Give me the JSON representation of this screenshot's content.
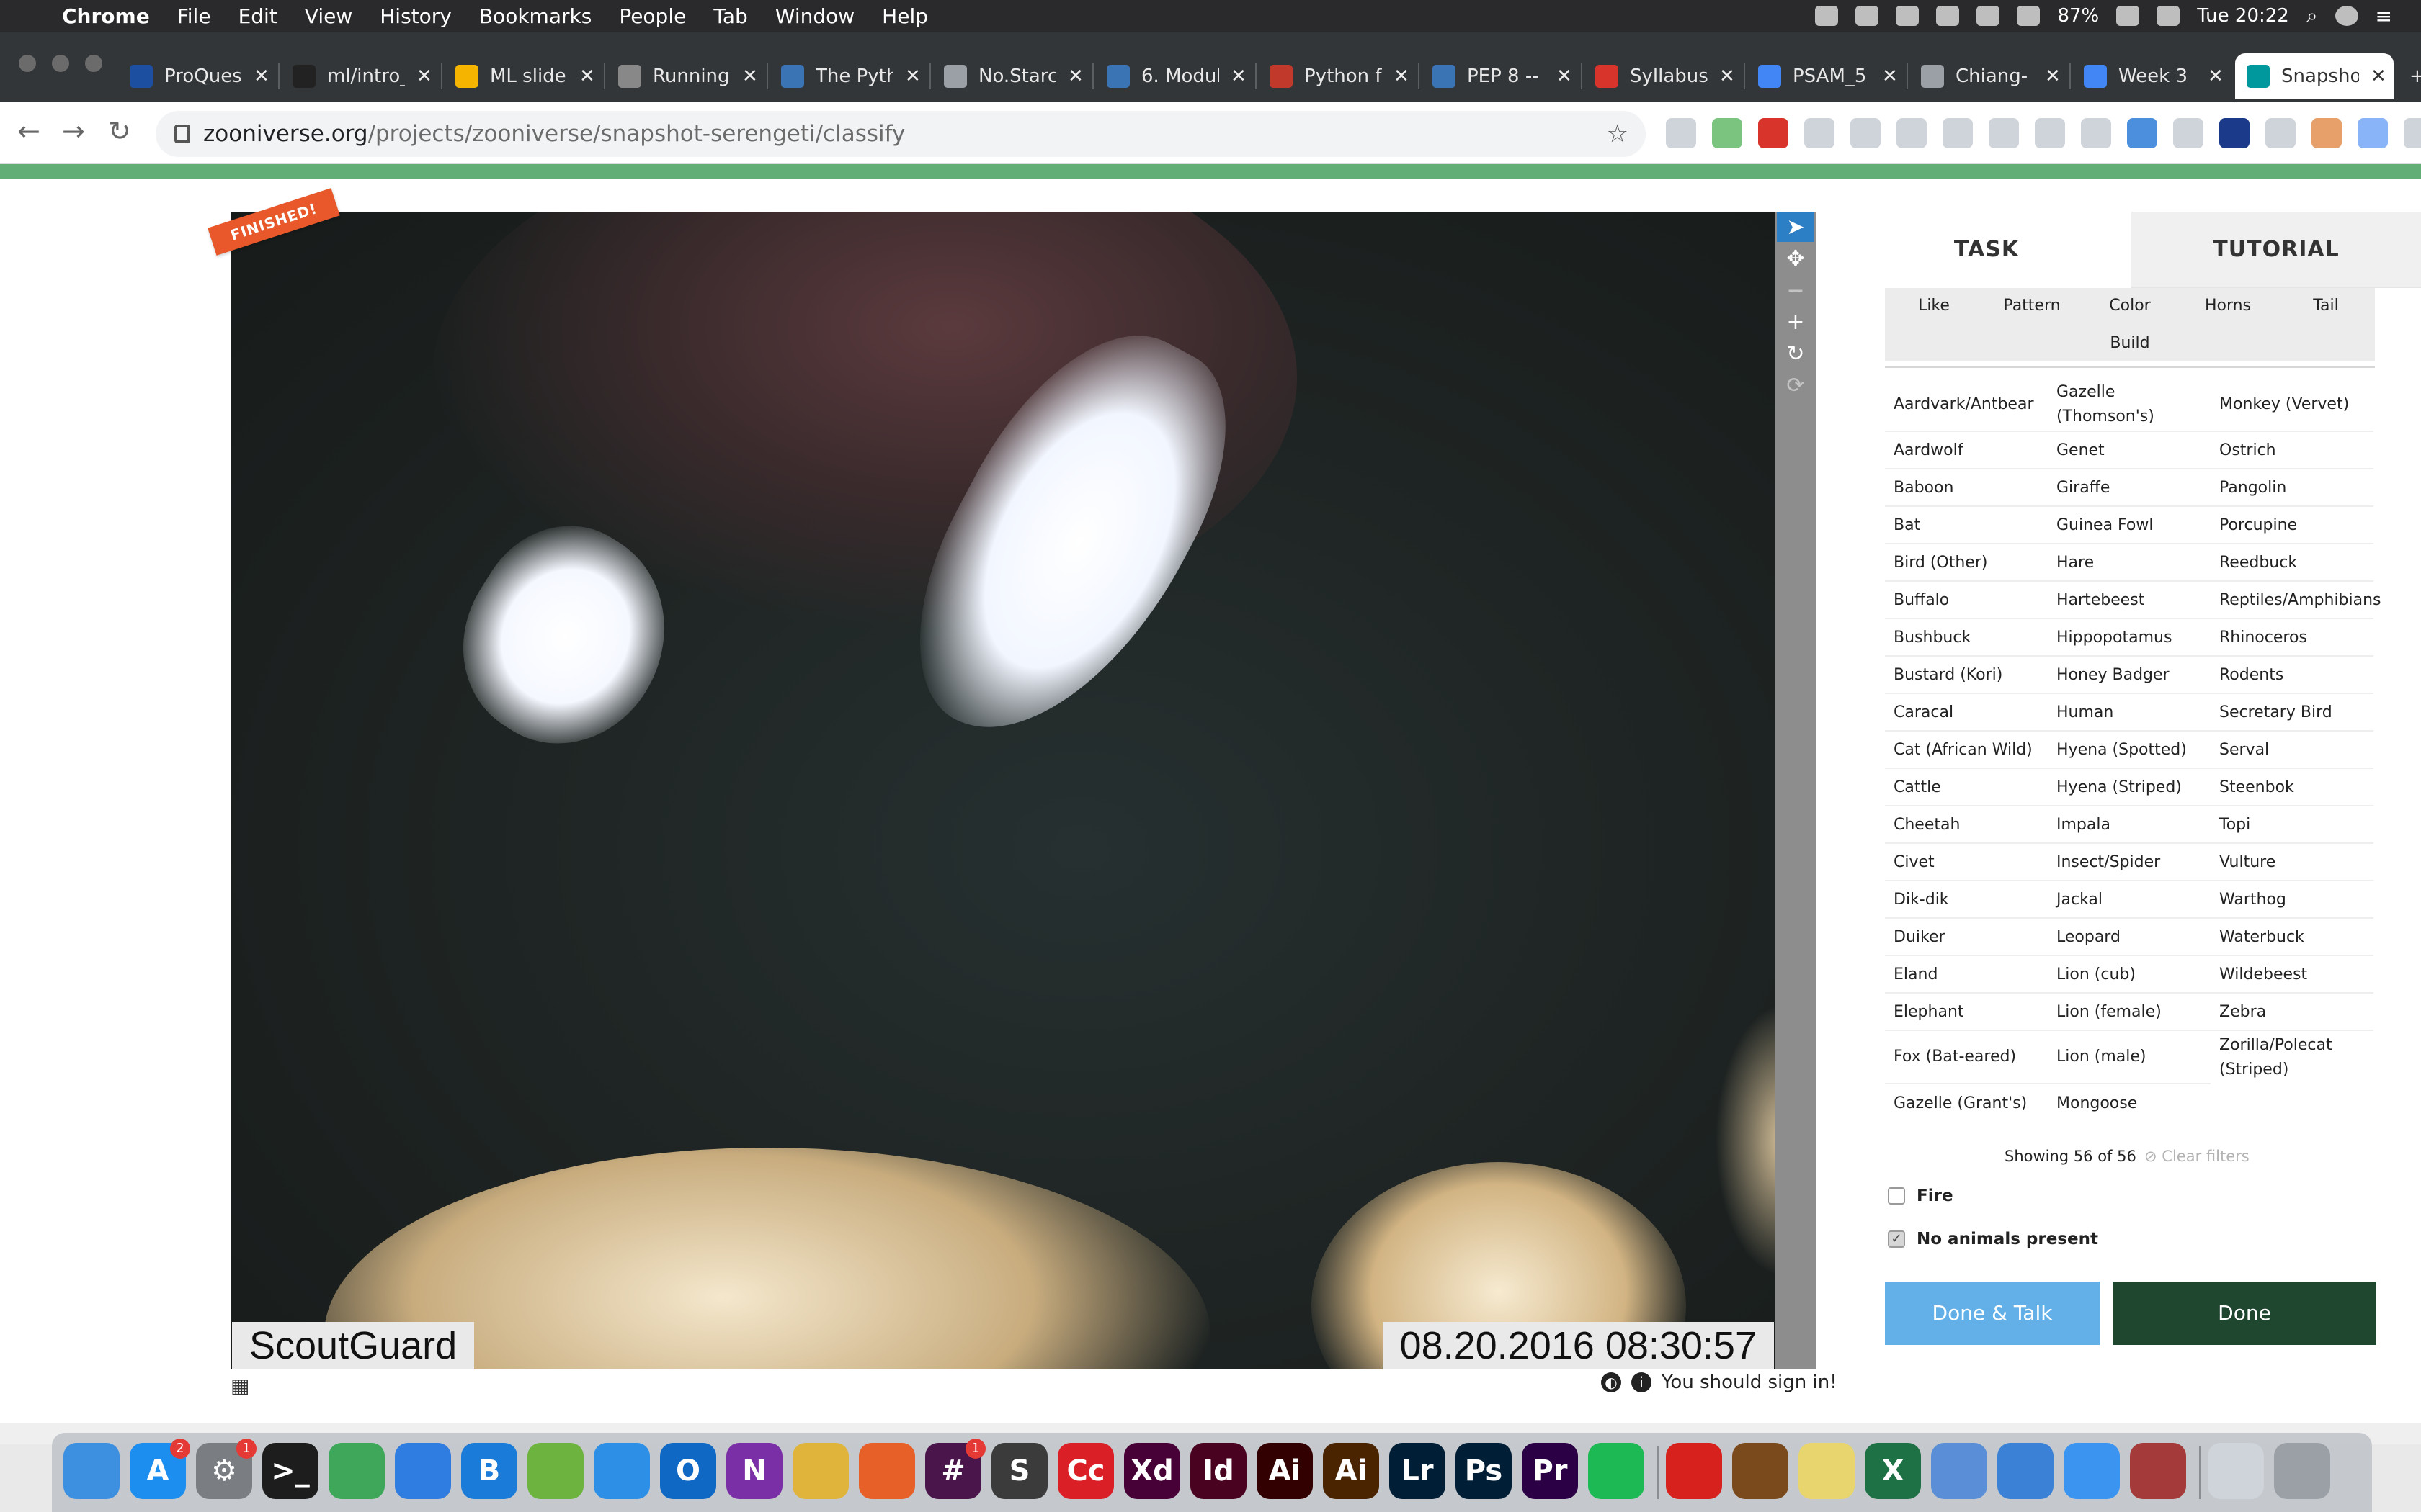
{
  "menubar": {
    "app_name": "Chrome",
    "items": [
      "File",
      "Edit",
      "View",
      "History",
      "Bookmarks",
      "People",
      "Tab",
      "Window",
      "Help"
    ],
    "battery": "87%",
    "clock": "Tue 20:22"
  },
  "tabs": [
    {
      "label": "ProQues",
      "color": "#1d4fa0"
    },
    {
      "label": "ml/intro_",
      "color": "#222222"
    },
    {
      "label": "ML slide",
      "color": "#f4b400"
    },
    {
      "label": "Running",
      "color": "#888888"
    },
    {
      "label": "The Pyth",
      "color": "#3b74b4"
    },
    {
      "label": "No.Starc",
      "color": "#9aa0a6"
    },
    {
      "label": "6. Modul",
      "color": "#3b74b4"
    },
    {
      "label": "Python f",
      "color": "#c0392b"
    },
    {
      "label": "PEP 8 --",
      "color": "#3b74b4"
    },
    {
      "label": "Syllabus",
      "color": "#d9342b"
    },
    {
      "label": "PSAM_5",
      "color": "#4285f4"
    },
    {
      "label": "Chiang-",
      "color": "#9aa0a6"
    },
    {
      "label": "Week 3",
      "color": "#4285f4"
    },
    {
      "label": "Snapsho",
      "color": "#00979d",
      "active": true
    }
  ],
  "address": {
    "host": "zooniverse.org",
    "path": "/projects/zooniverse/snapshot-serengeti/classify"
  },
  "subject": {
    "ribbon": "FINISHED!",
    "camera_brand": "ScoutGuard",
    "timestamp": "08.20.2016 08:30:57",
    "sign_in_notice": "You should sign in!"
  },
  "task_panel": {
    "tab_task": "TASK",
    "tab_tutorial": "TUTORIAL",
    "filters": [
      "Like",
      "Pattern",
      "Color",
      "Horns",
      "Tail",
      "Build"
    ],
    "species_columns": [
      [
        "Aardvark/Antbear",
        "Aardwolf",
        "Baboon",
        "Bat",
        "Bird (Other)",
        "Buffalo",
        "Bushbuck",
        "Bustard (Kori)",
        "Caracal",
        "Cat (African Wild)",
        "Cattle",
        "Cheetah",
        "Civet",
        "Dik-dik",
        "Duiker",
        "Eland",
        "Elephant",
        "Fox (Bat-eared)",
        "Gazelle (Grant's)"
      ],
      [
        "Gazelle (Thomson's)",
        "Genet",
        "Giraffe",
        "Guinea Fowl",
        "Hare",
        "Hartebeest",
        "Hippopotamus",
        "Honey Badger",
        "Human",
        "Hyena (Spotted)",
        "Hyena (Striped)",
        "Impala",
        "Insect/Spider",
        "Jackal",
        "Leopard",
        "Lion (cub)",
        "Lion (female)",
        "Lion (male)",
        "Mongoose"
      ],
      [
        "Monkey (Vervet)",
        "Ostrich",
        "Pangolin",
        "Porcupine",
        "Reedbuck",
        "Reptiles/Amphibians",
        "Rhinoceros",
        "Rodents",
        "Secretary Bird",
        "Serval",
        "Steenbok",
        "Topi",
        "Vulture",
        "Warthog",
        "Waterbuck",
        "Wildebeest",
        "Zebra",
        "Zorilla/Polecat (Striped)"
      ]
    ],
    "showing": "Showing 56 of 56",
    "clear_filters": "Clear filters",
    "fire_label": "Fire",
    "fire_checked": false,
    "no_animals_label": "No animals present",
    "no_animals_checked": true,
    "done_talk_label": "Done & Talk",
    "done_label": "Done"
  },
  "dock": [
    {
      "name": "Finder",
      "color": "#3d8fe0",
      "glyph": ""
    },
    {
      "name": "App Store",
      "color": "#1c8ef0",
      "glyph": "A",
      "badge": "2"
    },
    {
      "name": "System Preferences",
      "color": "#7a7d82",
      "glyph": "⚙",
      "badge": "1"
    },
    {
      "name": "Terminal",
      "color": "#1d1d1d",
      "glyph": ">_"
    },
    {
      "name": "Maps",
      "color": "#3fa75a",
      "glyph": ""
    },
    {
      "name": "OneDrive",
      "color": "#2f7de0",
      "glyph": ""
    },
    {
      "name": "Box",
      "color": "#1b7bd8",
      "glyph": "B"
    },
    {
      "name": "Other",
      "color": "#6db33f",
      "glyph": ""
    },
    {
      "name": "Messenger",
      "color": "#2d8fe6",
      "glyph": ""
    },
    {
      "name": "Outlook",
      "color": "#0f68c4",
      "glyph": "O"
    },
    {
      "name": "OneNote",
      "color": "#7b2fa6",
      "glyph": "N"
    },
    {
      "name": "Chrome",
      "color": "#e0b43a",
      "glyph": ""
    },
    {
      "name": "Firefox",
      "color": "#e66028",
      "glyph": ""
    },
    {
      "name": "Slack",
      "color": "#4a154b",
      "glyph": "#",
      "badge": "1"
    },
    {
      "name": "Sublime Text",
      "color": "#3b3b3b",
      "glyph": "S"
    },
    {
      "name": "Creative Cloud",
      "color": "#da1f26",
      "glyph": "Cc"
    },
    {
      "name": "Adobe XD",
      "color": "#470137",
      "glyph": "Xd"
    },
    {
      "name": "InDesign",
      "color": "#49021f",
      "glyph": "Id"
    },
    {
      "name": "Illustrator",
      "color": "#330000",
      "glyph": "Ai"
    },
    {
      "name": "Illustrator CC",
      "color": "#4a2300",
      "glyph": "Ai"
    },
    {
      "name": "Lightroom",
      "color": "#001e36",
      "glyph": "Lr"
    },
    {
      "name": "Photoshop",
      "color": "#001e36",
      "glyph": "Ps"
    },
    {
      "name": "Premiere Pro",
      "color": "#2b0045",
      "glyph": "Pr"
    },
    {
      "name": "Spotify",
      "color": "#1db954",
      "glyph": ""
    },
    {
      "name": "Acrobat",
      "color": "#d6211c",
      "glyph": ""
    },
    {
      "name": "Preview",
      "color": "#7a4a1c",
      "glyph": ""
    },
    {
      "name": "Stickies",
      "color": "#e8d56d",
      "glyph": ""
    },
    {
      "name": "Excel",
      "color": "#1e7145",
      "glyph": "X"
    },
    {
      "name": "Charts",
      "color": "#5a8fd8",
      "glyph": ""
    },
    {
      "name": "Keynote",
      "color": "#3b82d6",
      "glyph": ""
    },
    {
      "name": "Messages",
      "color": "#3a94f0",
      "glyph": ""
    },
    {
      "name": "Photo Booth",
      "color": "#a53a3a",
      "glyph": ""
    },
    {
      "name": "Downloads",
      "color": "#cfd4da",
      "glyph": ""
    },
    {
      "name": "Trash",
      "color": "#9aa0a6",
      "glyph": ""
    }
  ]
}
